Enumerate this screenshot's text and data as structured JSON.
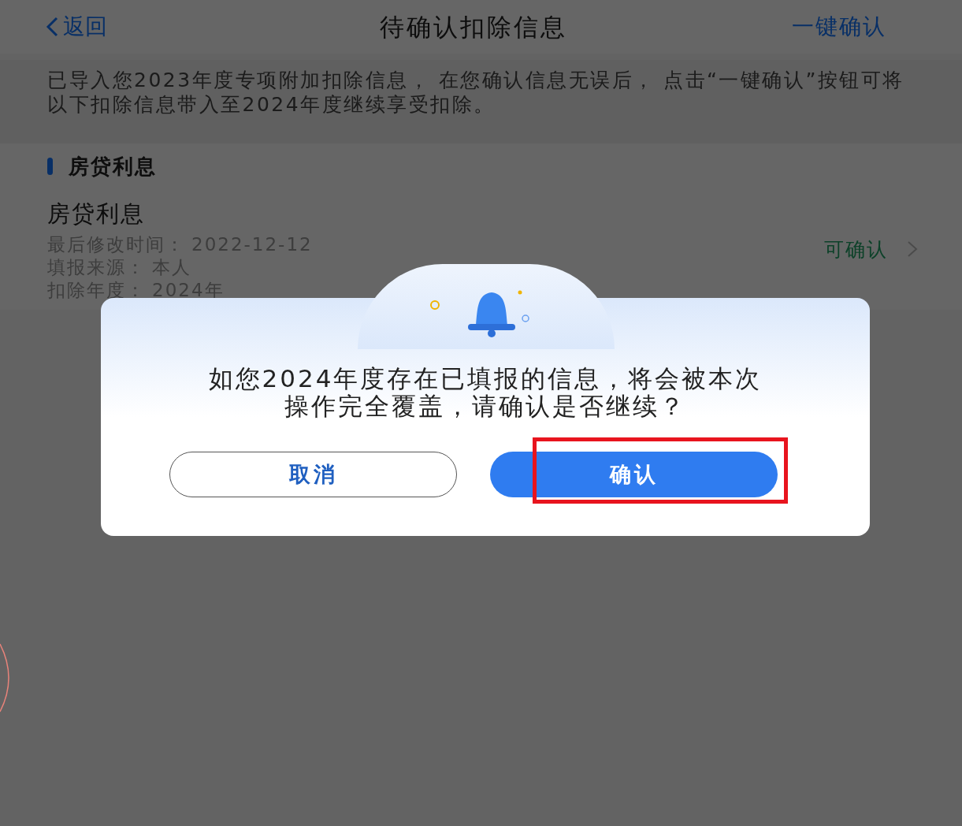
{
  "header": {
    "back": "返回",
    "title": "待确认扣除信息",
    "action": "一键确认"
  },
  "notice": "已导入您2023年度专项附加扣除信息， 在您确认信息无误后， 点击“一键确认”按钮可将以下扣除信息带入至2024年度继续享受扣除。",
  "section": {
    "title": "房贷利息"
  },
  "items": [
    {
      "title": "房贷利息",
      "fields": [
        {
          "label": "最后修改时间：",
          "value": "2022-12-12"
        },
        {
          "label": "填报来源：",
          "value": "本人"
        },
        {
          "label": "扣除年度：",
          "value": "2024年"
        }
      ],
      "status": "可确认"
    }
  ],
  "dialog": {
    "message": "如您2024年度存在已填报的信息，将会被本次操作完全覆盖，请确认是否继续？",
    "buttons": [
      {
        "label": "取消",
        "kind": "secondary",
        "highlighted": false
      },
      {
        "label": "确认",
        "kind": "primary",
        "highlighted": true
      }
    ]
  }
}
